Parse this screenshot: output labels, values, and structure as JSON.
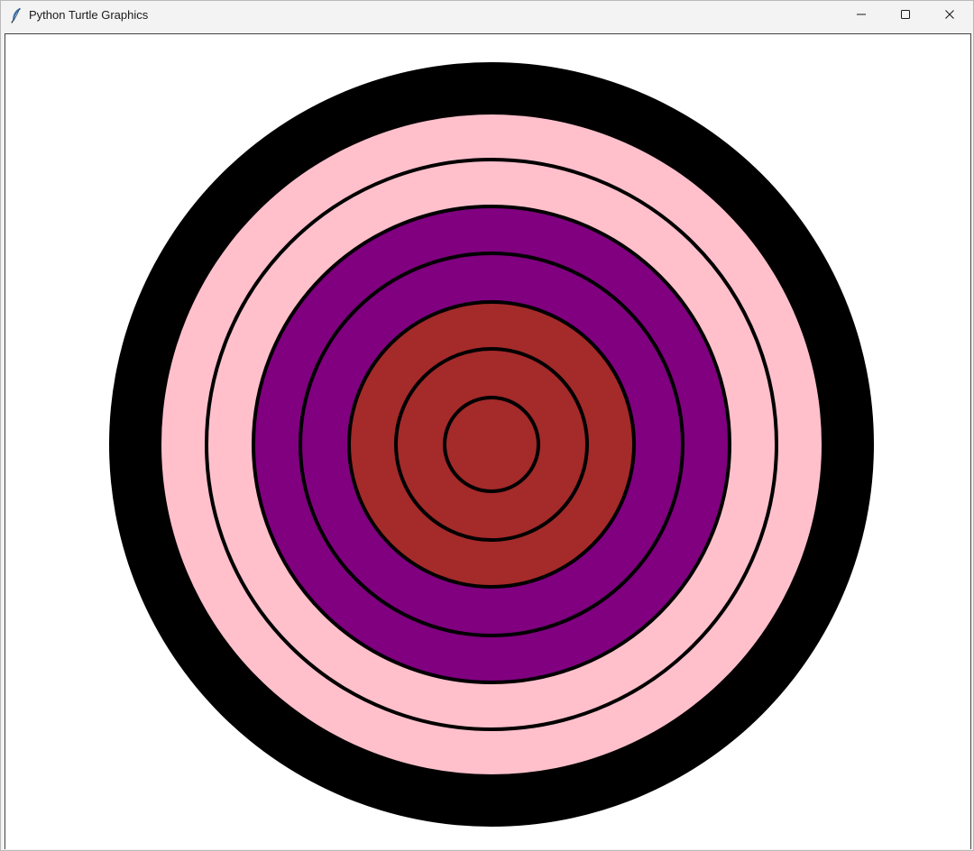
{
  "window": {
    "title": "Python Turtle Graphics",
    "icon": "feather-icon",
    "controls": {
      "minimize": "minimize-icon",
      "maximize": "maximize-icon",
      "close": "close-icon"
    }
  },
  "target": {
    "background": "#ffffff",
    "rings": [
      {
        "fill": "#000000",
        "outlined": false
      },
      {
        "fill": "#ffc0cb",
        "outlined": false
      },
      {
        "fill": "#ffc0cb",
        "outlined": true
      },
      {
        "fill": "#800080",
        "outlined": true
      },
      {
        "fill": "#800080",
        "outlined": true
      },
      {
        "fill": "#a52a2a",
        "outlined": true
      },
      {
        "fill": "#a52a2a",
        "outlined": true
      },
      {
        "fill": "#a52a2a",
        "outlined": true
      }
    ],
    "outline_color": "#000000"
  }
}
